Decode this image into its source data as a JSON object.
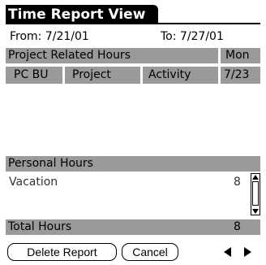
{
  "title": "Time Report View",
  "period": {
    "from": "From: 7/21/01",
    "to": "To: 7/27/01"
  },
  "project_section": {
    "label": "Project Related Hours",
    "day_label": "Mon",
    "columns": [
      "PC BU",
      "Project",
      "Activity",
      "7/23"
    ]
  },
  "personal_section": {
    "label": "Personal Hours",
    "rows": [
      {
        "name": "Vacation",
        "hours": "8"
      }
    ]
  },
  "total": {
    "label": "Total Hours",
    "hours": "8"
  },
  "buttons": {
    "delete": "Delete Report",
    "cancel": "Cancel"
  },
  "icons": {
    "scroll_up": "scroll-up-arrow",
    "scroll_down": "scroll-down-arrow",
    "prev": "left-arrow",
    "next": "right-arrow"
  }
}
